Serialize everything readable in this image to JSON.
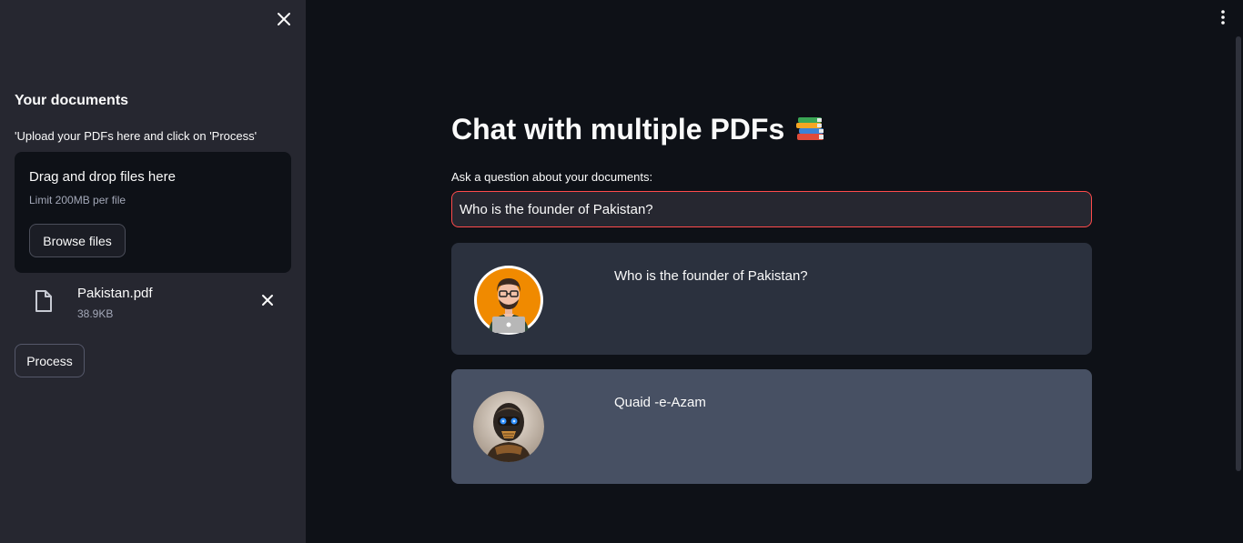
{
  "sidebar": {
    "title": "Your documents",
    "caption": "'Upload your PDFs here and click on 'Process'",
    "dropzone": {
      "title": "Drag and drop files here",
      "limit": "Limit 200MB per file",
      "browse_label": "Browse files"
    },
    "file": {
      "name": "Pakistan.pdf",
      "size": "38.9KB"
    },
    "process_label": "Process"
  },
  "main": {
    "title": "Chat with multiple PDFs",
    "title_icon": "books-emoji",
    "question_label": "Ask a question about your documents:",
    "question_value": "Who is the founder of Pakistan?",
    "messages": [
      {
        "role": "user",
        "text": "Who is the founder of Pakistan?",
        "avatar": "user-avatar"
      },
      {
        "role": "bot",
        "text": "Quaid -e-Azam",
        "avatar": "bot-avatar"
      }
    ]
  },
  "colors": {
    "background": "#0e1117",
    "sidebar": "#262730",
    "user_message": "#2b313e",
    "bot_message": "#475063",
    "input_focus": "#ff4b4b"
  }
}
